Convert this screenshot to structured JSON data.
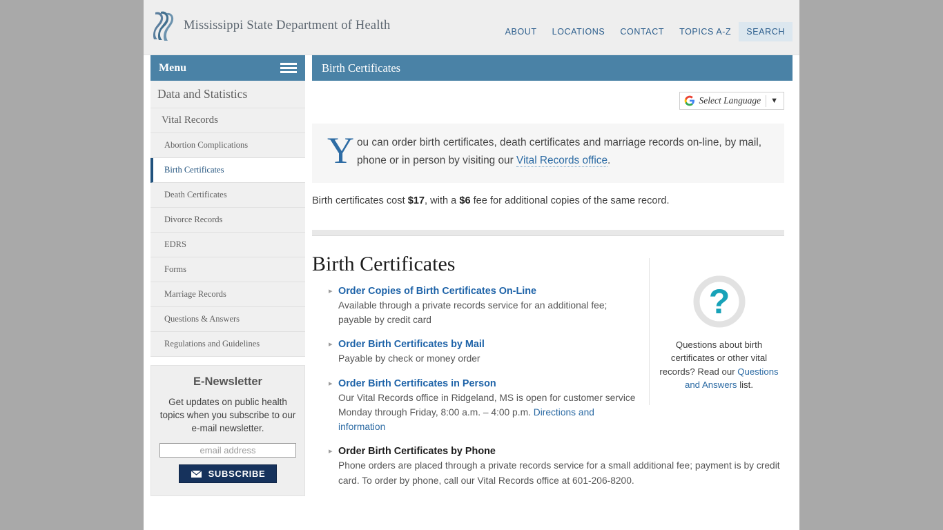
{
  "site": {
    "brand_name": "Mississippi State Department of Health",
    "logo_icon": "msdh-logo-icon"
  },
  "top_nav": {
    "items": [
      {
        "label": "ABOUT",
        "active": false
      },
      {
        "label": "LOCATIONS",
        "active": false
      },
      {
        "label": "CONTACT",
        "active": false
      },
      {
        "label": "TOPICS A-Z",
        "active": false
      },
      {
        "label": "SEARCH",
        "active": true
      }
    ]
  },
  "sidebar": {
    "menu_label": "Menu",
    "menu_icon": "hamburger-icon",
    "items": [
      {
        "label": "Data and Statistics",
        "level": 1,
        "current": false
      },
      {
        "label": "Vital Records",
        "level": 2,
        "current": false
      },
      {
        "label": "Abortion Complications",
        "level": 3,
        "current": false
      },
      {
        "label": "Birth Certificates",
        "level": 3,
        "current": true
      },
      {
        "label": "Death Certificates",
        "level": 3,
        "current": false
      },
      {
        "label": "Divorce Records",
        "level": 3,
        "current": false
      },
      {
        "label": "EDRS",
        "level": 3,
        "current": false
      },
      {
        "label": "Forms",
        "level": 3,
        "current": false
      },
      {
        "label": "Marriage Records",
        "level": 3,
        "current": false
      },
      {
        "label": "Questions & Answers",
        "level": 3,
        "current": false
      },
      {
        "label": "Regulations and Guidelines",
        "level": 3,
        "current": false
      }
    ],
    "newsletter": {
      "title": "E-Newsletter",
      "body": "Get updates on public health topics when you subscribe to our e-mail newsletter.",
      "email_placeholder": "email address",
      "email_value": "",
      "subscribe_label": "SUBSCRIBE",
      "subscribe_icon": "envelope-icon"
    }
  },
  "main": {
    "page_title": "Birth Certificates",
    "translate": {
      "icon": "google-g-icon",
      "label": "Select Language",
      "caret": "▼"
    },
    "intro": {
      "dropcap": "Y",
      "text_before": "ou can order birth certificates, death certificates and marriage records on-line, by mail, phone or in person by visiting our ",
      "link": "Vital Records office",
      "text_after": "."
    },
    "cost_note": {
      "part1": "Birth certificates cost ",
      "price": "$17",
      "part2": ", with a ",
      "extra": "$6",
      "part3": " fee for additional copies of the same record."
    },
    "section_title": "Birth Certificates",
    "links": [
      {
        "title": "Order Copies of Birth Certificates On-Line",
        "is_link": true,
        "desc": "Available through a private records service for an additional fee; payable by credit card",
        "sublink": ""
      },
      {
        "title": "Order Birth Certificates by Mail",
        "is_link": true,
        "desc": "Payable by check or money order",
        "sublink": ""
      },
      {
        "title": "Order Birth Certificates in Person",
        "is_link": true,
        "desc": "Our Vital Records office in Ridgeland, MS is open for customer service Monday through Friday, 8:00 a.m. – 4:00 p.m. ",
        "sublink": "Directions and information"
      },
      {
        "title": "Order Birth Certificates by Phone",
        "is_link": false,
        "desc": "Phone orders are placed through a private records service for a small additional fee; payment is by credit card. To order by phone, call our Vital Records office at 601-206-8200.",
        "sublink": ""
      }
    ],
    "question_box": {
      "icon": "question-mark-icon",
      "text_before": "Questions about birth certificates or other vital records? Read our ",
      "link": "Questions and Answers",
      "text_after": " list."
    }
  },
  "colors": {
    "header_blue": "#4a82a6",
    "link_blue": "#1e63a8",
    "active_nav": "#21527d",
    "newsletter_button": "#16325c",
    "question_teal": "#17a2b8",
    "page_background": "#a9a9a9"
  }
}
